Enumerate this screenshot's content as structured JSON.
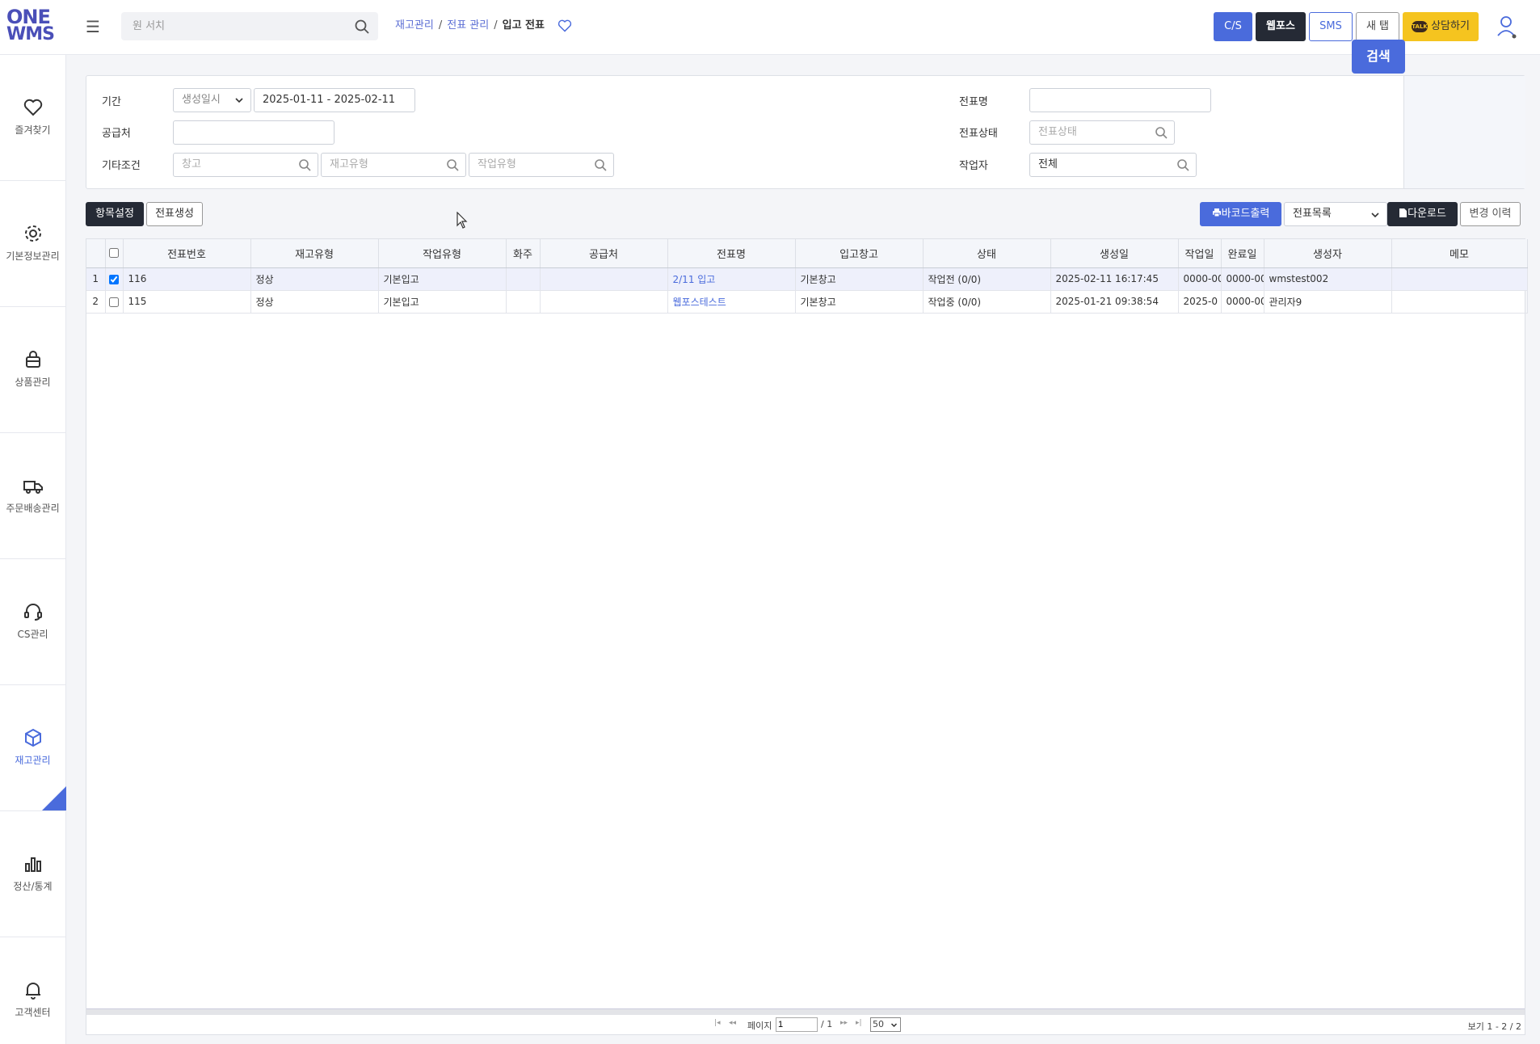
{
  "header": {
    "logo_line1": "ONE",
    "logo_line2": "WMS",
    "search_placeholder": "원 서치",
    "breadcrumb": [
      "재고관리",
      "전표 관리",
      "입고 전표"
    ],
    "buttons": {
      "cs": "C/S",
      "webpos": "웹포스",
      "sms": "SMS",
      "newtab": "새 탭",
      "talk_badge": "TALK",
      "talk": "상담하기"
    }
  },
  "sidebar": {
    "items": [
      {
        "label": "즐겨찾기",
        "icon": "heart-icon"
      },
      {
        "label": "기본정보관리",
        "icon": "gear-icon"
      },
      {
        "label": "상품관리",
        "icon": "bag-icon"
      },
      {
        "label": "주문배송관리",
        "icon": "truck-icon"
      },
      {
        "label": "CS관리",
        "icon": "headset-icon"
      },
      {
        "label": "재고관리",
        "icon": "cube-icon",
        "active": true
      },
      {
        "label": "정산/통계",
        "icon": "bar-chart-icon"
      },
      {
        "label": "고객센터",
        "icon": "bell-icon"
      }
    ]
  },
  "filter": {
    "period_label": "기간",
    "period_type": "생성일시",
    "period_range": "2025-01-11 - 2025-02-11",
    "supplier_label": "공급처",
    "supplier_value": "",
    "etc_label": "기타조건",
    "warehouse_placeholder": "창고",
    "stock_type_placeholder": "재고유형",
    "work_type_placeholder": "작업유형",
    "slip_name_label": "전표명",
    "slip_name_value": "",
    "slip_status_label": "전표상태",
    "slip_status_placeholder": "전표상태",
    "worker_label": "작업자",
    "worker_value": "전체",
    "search_button": "검색"
  },
  "toolbar": {
    "column_setting": "항목설정",
    "create_slip": "전표생성",
    "barcode_print": "바코드출력",
    "slip_list": "전표목록",
    "download": "다운로드",
    "change_history": "변경 이력"
  },
  "grid": {
    "columns": [
      "전표번호",
      "재고유형",
      "작업유형",
      "화주",
      "공급처",
      "전표명",
      "입고창고",
      "상태",
      "생성일",
      "작업일",
      "완료일",
      "생성자",
      "메모"
    ],
    "rows": [
      {
        "rn": "1",
        "checked": true,
        "slip_no": "116",
        "stock_type": "정상",
        "work_type": "기본입고",
        "owner": "",
        "supplier": "",
        "slip_name": "2/11 입고",
        "warehouse": "기본창고",
        "status": "작업전 (0/0)",
        "created": "2025-02-11 16:17:45",
        "worked": "0000-00",
        "completed": "0000-00",
        "creator": "wmstest002",
        "memo": ""
      },
      {
        "rn": "2",
        "checked": false,
        "slip_no": "115",
        "stock_type": "정상",
        "work_type": "기본입고",
        "owner": "",
        "supplier": "",
        "slip_name": "웹포스테스트",
        "warehouse": "기본창고",
        "status": "작업중 (0/0)",
        "created": "2025-01-21 09:38:54",
        "worked": "2025-0",
        "completed": "0000-00",
        "creator": "관리자9",
        "memo": ""
      }
    ]
  },
  "pager": {
    "page_label": "페이지",
    "page_value": "1",
    "page_total": "/ 1",
    "page_size": "50",
    "info": "보기 1 - 2 / 2"
  },
  "colors": {
    "accent": "#4a6bdc",
    "dark": "#252a35",
    "talk": "#f5c41f"
  }
}
